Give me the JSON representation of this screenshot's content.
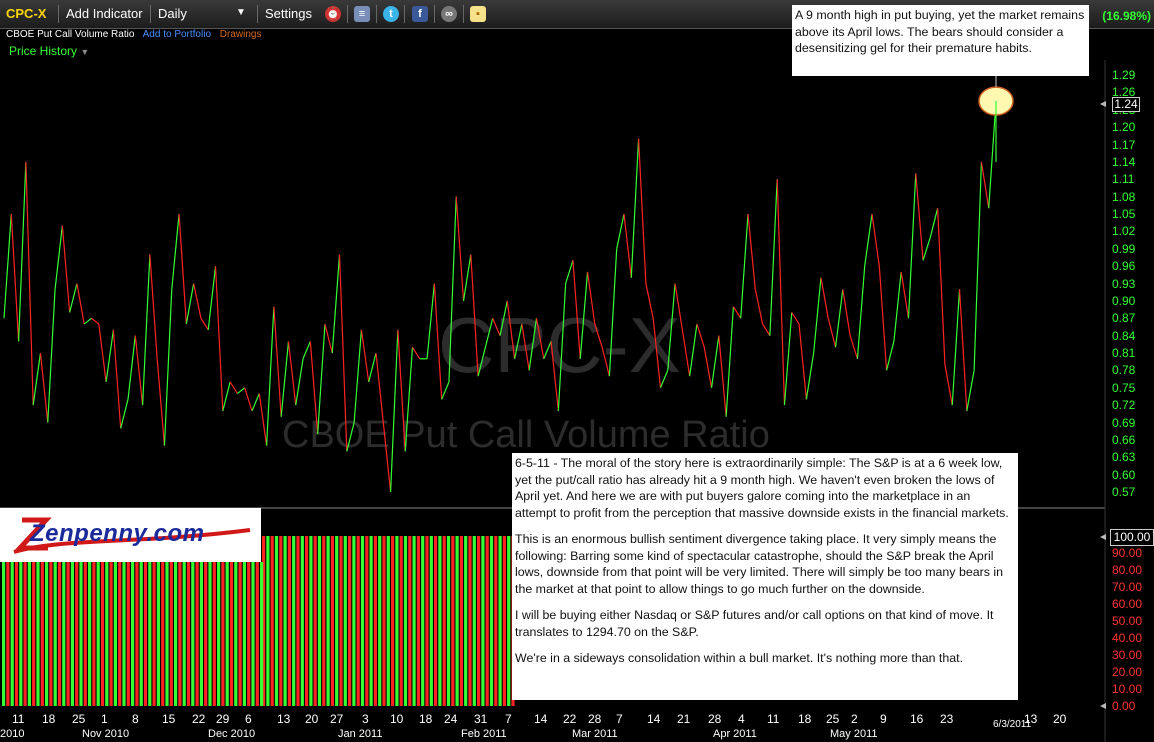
{
  "toolbar": {
    "symbol": "CPC-X",
    "add_indicator": "Add Indicator",
    "period": "Daily",
    "settings": "Settings",
    "change_pct": "(16.98%)",
    "icons": [
      "alarm-icon",
      "notes-icon",
      "twitter-icon",
      "facebook-icon",
      "binoculars-icon",
      "sticky-note-icon"
    ]
  },
  "subheader": {
    "name": "CBOE Put Call Volume Ratio",
    "add_to_portfolio": "Add to Portfolio",
    "drawings": "Drawings",
    "price_history": "Price History"
  },
  "watermark": {
    "symbol": "CPC-X",
    "name": "CBOE Put Call Volume Ratio"
  },
  "current_price": "1.24",
  "volume_max_label": "100.00",
  "logo_text": "Zenpenny.com",
  "date_marker": "6/3/2011",
  "annotations": {
    "top": "A 9 month high in put buying, yet the market remains above its April lows. The bears should consider a desensitizing gel for their premature habits.",
    "main": [
      "6-5-11 - The moral of the story here is extraordinarily simple: The S&P is at a 6 week low, yet the put/call ratio has already hit a 9 month high. We haven't even broken the lows of April yet. And here we are with put buyers galore coming into the marketplace in an attempt to profit from the perception that massive downside exists in the financial markets.",
      "This is an enormous bullish sentiment divergence taking place. It very simply means the following: Barring some kind of spectacular catastrophe, should the S&P break the April lows, downside from that point will be very limited. There will simply be too many bears in the market at that point to allow things to go much further on the downside.",
      "I will be buying either Nasdaq or S&P futures and/or call options on that kind of move. It translates to 1294.70 on the S&P.",
      "We're in a sideways consolidation within a bull market. It's nothing more than that."
    ]
  },
  "colors": {
    "up": "#33ff33",
    "down": "#ff2222",
    "accent": "#ffd700"
  },
  "chart_data": {
    "type": "line",
    "title": "CBOE Put Call Volume Ratio",
    "symbol": "CPC-X",
    "y_ticks": [
      "1.29",
      "1.26",
      "1.23",
      "1.20",
      "1.17",
      "1.14",
      "1.11",
      "1.08",
      "1.05",
      "1.02",
      "0.99",
      "0.96",
      "0.93",
      "0.90",
      "0.87",
      "0.84",
      "0.81",
      "0.78",
      "0.75",
      "0.72",
      "0.69",
      "0.66",
      "0.63",
      "0.60",
      "0.57"
    ],
    "volume_ticks": [
      "90.00",
      "80.00",
      "70.00",
      "60.00",
      "50.00",
      "40.00",
      "30.00",
      "20.00",
      "10.00",
      "0.00"
    ],
    "ylim": [
      0.555,
      1.31
    ],
    "x_day_labels": [
      "11",
      "18",
      "25",
      "1",
      "8",
      "15",
      "22",
      "29",
      "6",
      "13",
      "20",
      "27",
      "3",
      "10",
      "18",
      "24",
      "31",
      "7",
      "14",
      "22",
      "28",
      "7",
      "14",
      "21",
      "28",
      "4",
      "11",
      "18",
      "25",
      "2",
      "9",
      "16",
      "23",
      "13",
      "20"
    ],
    "x_month_labels": [
      "2010",
      "Nov 2010",
      "Dec 2010",
      "Jan 2011",
      "Feb 2011",
      "Mar 2011",
      "Apr 2011",
      "May 2011"
    ],
    "values": [
      0.87,
      1.05,
      0.83,
      1.14,
      0.72,
      0.81,
      0.69,
      0.92,
      1.03,
      0.88,
      0.93,
      0.86,
      0.87,
      0.86,
      0.76,
      0.85,
      0.68,
      0.73,
      0.84,
      0.72,
      0.98,
      0.8,
      0.65,
      0.92,
      1.05,
      0.86,
      0.93,
      0.87,
      0.85,
      0.96,
      0.71,
      0.76,
      0.74,
      0.75,
      0.71,
      0.74,
      0.65,
      0.89,
      0.7,
      0.83,
      0.72,
      0.8,
      0.83,
      0.67,
      0.86,
      0.81,
      0.98,
      0.64,
      0.69,
      0.85,
      0.76,
      0.81,
      0.69,
      0.57,
      0.85,
      0.64,
      0.82,
      0.8,
      0.8,
      0.93,
      0.73,
      0.76,
      1.08,
      0.9,
      0.98,
      0.77,
      0.82,
      0.87,
      0.84,
      0.9,
      0.8,
      0.86,
      0.78,
      0.87,
      0.8,
      0.83,
      0.71,
      0.93,
      0.97,
      0.8,
      0.95,
      0.86,
      0.82,
      0.77,
      0.99,
      1.05,
      0.94,
      1.18,
      0.93,
      0.87,
      0.75,
      0.78,
      0.93,
      0.85,
      0.77,
      0.86,
      0.82,
      0.75,
      0.84,
      0.7,
      0.89,
      0.87,
      1.05,
      0.92,
      0.86,
      0.84,
      1.11,
      0.72,
      0.88,
      0.86,
      0.73,
      0.81,
      0.94,
      0.87,
      0.82,
      0.92,
      0.84,
      0.8,
      0.96,
      1.05,
      0.96,
      0.78,
      0.83,
      0.95,
      0.87,
      1.12,
      0.97,
      1.01,
      1.06,
      0.79,
      0.72,
      0.92,
      0.71,
      0.78,
      1.14,
      1.06,
      1.245
    ],
    "volume_series": "Put/Call volume columns, 100% scale, alternating green/red"
  }
}
